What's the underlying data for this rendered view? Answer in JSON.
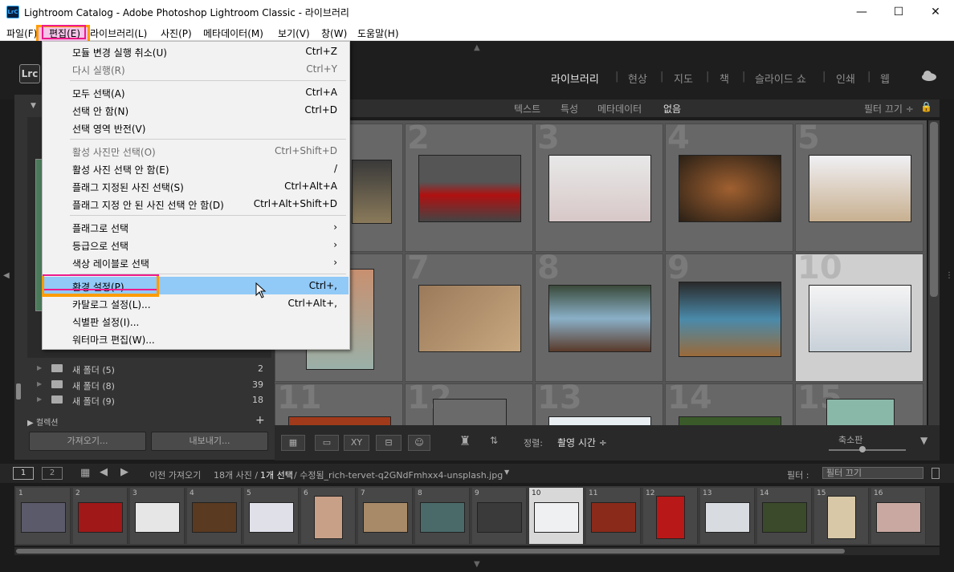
{
  "window": {
    "title": "Lightroom Catalog - Adobe Photoshop Lightroom Classic - 라이브러리",
    "app_icon": "LrC"
  },
  "menubar": [
    "파일(F)",
    "편집(E)",
    "라이브러리(L)",
    "사진(P)",
    "메타데이터(M)",
    "보기(V)",
    "창(W)",
    "도움말(H)"
  ],
  "logo": "Lrc",
  "modules": [
    "라이브러리",
    "현상",
    "지도",
    "책",
    "슬라이드 쇼",
    "인쇄",
    "웹"
  ],
  "filter_bar": {
    "items": [
      "텍스트",
      "특성",
      "메타데이터",
      "없음"
    ],
    "right": "필터 끄기 ÷"
  },
  "edit_menu": {
    "items": [
      {
        "label": "모듈 변경 실행 취소(U)",
        "shortcut": "Ctrl+Z",
        "disabled": false
      },
      {
        "label": "다시 실행(R)",
        "shortcut": "Ctrl+Y",
        "disabled": true
      },
      {
        "label": "모두 선택(A)",
        "shortcut": "Ctrl+A",
        "disabled": false
      },
      {
        "label": "선택 안 함(N)",
        "shortcut": "Ctrl+D",
        "disabled": false
      },
      {
        "label": "선택 영역 반전(V)",
        "shortcut": "",
        "disabled": false
      },
      {
        "label": "활성 사진만 선택(O)",
        "shortcut": "Ctrl+Shift+D",
        "disabled": true
      },
      {
        "label": "활성 사진 선택 안 함(E)",
        "shortcut": "/",
        "disabled": false
      },
      {
        "label": "플래그 지정된 사진 선택(S)",
        "shortcut": "Ctrl+Alt+A",
        "disabled": false
      },
      {
        "label": "플래그 지정 안 된 사진 선택 안 함(D)",
        "shortcut": "Ctrl+Alt+Shift+D",
        "disabled": false
      },
      {
        "label": "플래그로 선택",
        "shortcut": "›",
        "disabled": false
      },
      {
        "label": "등급으로 선택",
        "shortcut": "›",
        "disabled": false
      },
      {
        "label": "색상 레이블로 선택",
        "shortcut": "›",
        "disabled": false
      },
      {
        "label": "환경 설정(P)...",
        "shortcut": "Ctrl+,",
        "disabled": false,
        "highlighted": true
      },
      {
        "label": "카탈로그 설정(L)...",
        "shortcut": "Ctrl+Alt+,",
        "disabled": false
      },
      {
        "label": "식별판 설정(I)...",
        "shortcut": "",
        "disabled": false
      },
      {
        "label": "워터마크 편집(W)...",
        "shortcut": "",
        "disabled": false
      }
    ]
  },
  "folders": [
    {
      "name": "새 폴더 (5)",
      "count": "2"
    },
    {
      "name": "새 폴더 (8)",
      "count": "39"
    },
    {
      "name": "새 폴더 (9)",
      "count": "18"
    }
  ],
  "collections_label": "컬렉션",
  "left_buttons": {
    "import": "가져오기...",
    "export": "내보내기..."
  },
  "grid_numbers": [
    "2",
    "3",
    "4",
    "5",
    "7",
    "8",
    "9",
    "10",
    "11",
    "12",
    "13",
    "14",
    "15"
  ],
  "toolbar": {
    "sort_label": "정렬:",
    "sort_value": "촬영 시간 ÷",
    "thumb_label": "축소판"
  },
  "filmstrip_header": {
    "pages": [
      "1",
      "2"
    ],
    "source": "이전 가져오기",
    "count": "18개 사진 /",
    "selected": "1개 선택",
    "filename": "/ 수정됨_rich-tervet-q2GNdFmhxx4-unsplash.jpg",
    "filter_label": "필터 :",
    "filter_value": "필터 끄기"
  },
  "filmstrip_numbers": [
    "1",
    "2",
    "3",
    "4",
    "5",
    "6",
    "7",
    "8",
    "9",
    "10",
    "11",
    "12",
    "13",
    "14",
    "15",
    "16"
  ],
  "colors": {
    "highlight_pink": "#ee1b8b",
    "highlight_orange": "#ff9c00",
    "menu_hover": "#91c9f7"
  }
}
